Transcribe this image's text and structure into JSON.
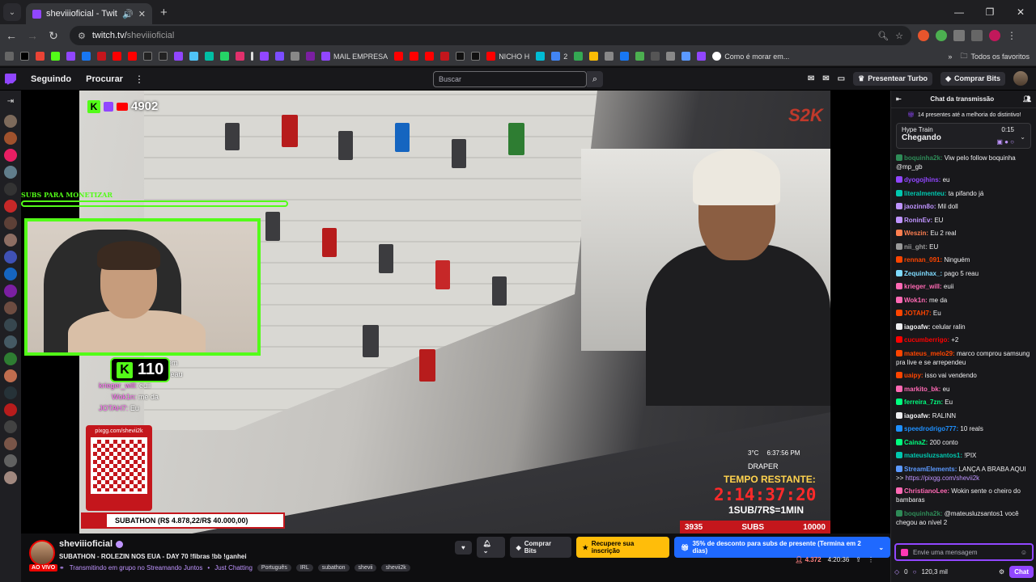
{
  "browser": {
    "tab_title": "sheviiioficial - Twitch",
    "url_host": "twitch.tv/",
    "url_path": "sheviiioficial"
  },
  "bookmarks": [
    {
      "label": "MAIL EMPRESA"
    },
    {
      "label": "NICHO H"
    },
    {
      "label": "2"
    },
    {
      "label": "Como é morar em..."
    }
  ],
  "bookmarks_all_label": "Todos os favoritos",
  "twitch_nav": {
    "following": "Seguindo",
    "browse": "Procurar",
    "search_placeholder": "Buscar",
    "turbo": "Presentear Turbo",
    "bits": "Comprar Bits"
  },
  "overlay": {
    "viewer_count": "4902",
    "subs_label": "SUBS PARA MONETIZAR",
    "kick_followers": "110",
    "qr_url": "pixgg.com/shevii2k",
    "subathon": "SUBATHON (R$ 4.878,22/R$ 40.000,00)",
    "temp": "3°C",
    "clock_time": "6:37:56 PM",
    "location": "DRAPER",
    "tempo_label": "TEMPO RESTANTE:",
    "timer": "2:14:37:20",
    "rate": "1SUB/7R$=1MIN",
    "subs_current": "3935",
    "subs_label2": "SUBS",
    "subs_goal": "10000",
    "brand": "S2K",
    "vchat": [
      {
        "user": "",
        "text": "élem"
      },
      {
        "user": "",
        "text": "5 reau"
      },
      {
        "user": "krieger_will:",
        "text": "euii"
      },
      {
        "user": "Wok1n:",
        "text": "me da"
      },
      {
        "user": "JOTAH7:",
        "text": "Eu"
      }
    ]
  },
  "chat": {
    "header": "Chat da transmissão",
    "gift_banner": "14 presentes até a melhoria do distintivo!",
    "hype_label": "Hype Train",
    "hype_status": "Chegando",
    "hype_time": "0:15",
    "messages": [
      {
        "user": "boquinha2k:",
        "color": "#2e8b57",
        "text": "Viw pelo follow boquinha @mp_gb"
      },
      {
        "user": "dyogojhins:",
        "color": "#9146ff",
        "text": "eu"
      },
      {
        "user": "literalmenteu:",
        "color": "#00c8af",
        "text": "ta pifando já"
      },
      {
        "user": "jaozinn8o:",
        "color": "#bf94ff",
        "text": "Mil doll"
      },
      {
        "user": "RoninEv:",
        "color": "#bf94ff",
        "text": "EU"
      },
      {
        "user": "Weszin:",
        "color": "#ff7f50",
        "text": "Eu 2 real"
      },
      {
        "user": "nii_ght:",
        "color": "#9a9a9a",
        "text": "EU"
      },
      {
        "user": "rennan_091:",
        "color": "#ff4500",
        "text": "Ninguém"
      },
      {
        "user": "Zequinhax_:",
        "color": "#7fdbff",
        "text": "pago 5 reau"
      },
      {
        "user": "krieger_will:",
        "color": "#ff69b4",
        "text": "euii"
      },
      {
        "user": "Wok1n:",
        "color": "#ff69b4",
        "text": "me da"
      },
      {
        "user": "JOTAH7:",
        "color": "#ff4500",
        "text": "Eu"
      },
      {
        "user": "iagoafw:",
        "color": "#efeff1",
        "text": "celular ralin"
      },
      {
        "user": "cucumberrigo:",
        "color": "#ff0000",
        "text": "+2"
      },
      {
        "user": "mateus_melo29:",
        "color": "#ff4500",
        "text": "marco comprou samsung pra live e se arrependeu"
      },
      {
        "user": "uaipy:",
        "color": "#ff4500",
        "text": "isso vai vendendo"
      },
      {
        "user": "markito_bk:",
        "color": "#ff69b4",
        "text": "eu"
      },
      {
        "user": "ferreira_7zn:",
        "color": "#00ff7f",
        "text": "Eu"
      },
      {
        "user": "iagoafw:",
        "color": "#efeff1",
        "text": "RALINN"
      },
      {
        "user": "speedrodrigo777:",
        "color": "#1e90ff",
        "text": "10 reals"
      },
      {
        "user": "CainaZ:",
        "color": "#00ff7f",
        "text": "200 conto"
      },
      {
        "user": "mateusluzsantos1:",
        "color": "#00c8af",
        "text": "!PIX"
      },
      {
        "user": "StreamElements:",
        "color": "#5b99ff",
        "text": "LANÇA A BRABA AQUI >>",
        "link": "https://pixgg.com/shevii2k"
      },
      {
        "user": "ChristianoLee:",
        "color": "#ff69b4",
        "text": "Wokin sente o cheiro do bambaras"
      },
      {
        "user": "boquinha2k:",
        "color": "#2e8b57",
        "text": "@mateusluzsantos1 você chegou ao nível 2"
      }
    ],
    "input_placeholder": "Envie uma mensagem",
    "points_a": "0",
    "points_b": "120,3 mil",
    "send_label": "Chat"
  },
  "stream": {
    "channel": "sheviiioficial",
    "live": "AO VIVO",
    "title": "SUBATHON - ROLEZIN NOS EUA - DAY 70 !fibras !bb !ganhei",
    "group": "Transmitindo em grupo no Streamando Juntos",
    "category": "Just Chatting",
    "tags": [
      "Português",
      "IRL",
      "subathon",
      "shevii",
      "shevii2k"
    ],
    "buy_bits": "Comprar Bits",
    "resub": "Recupere sua inscrição",
    "discount": "35% de desconto para subs de presente (Termina em 2 dias)",
    "viewers": "4.372",
    "uptime": "4:20:36"
  },
  "colors": {
    "twitch_purple": "#9146ff",
    "kick_green": "#53fc18",
    "live_red": "#eb0400"
  }
}
